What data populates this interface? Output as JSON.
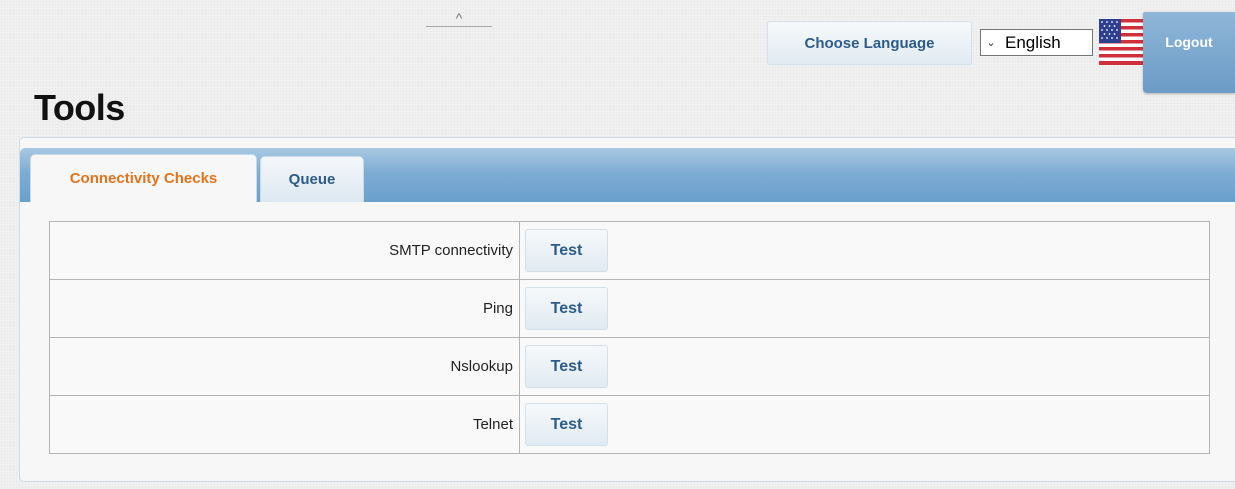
{
  "header": {
    "collapse_glyph": "^",
    "choose_language_label": "Choose Language",
    "language_selected": "English",
    "language_chevron": "⌄",
    "flag_icon": "us-flag-icon",
    "logout_label": "Logout"
  },
  "page": {
    "title": "Tools"
  },
  "tabs": [
    {
      "label": "Connectivity Checks",
      "active": true
    },
    {
      "label": "Queue",
      "active": false
    }
  ],
  "checks": [
    {
      "label": "SMTP connectivity",
      "button": "Test"
    },
    {
      "label": "Ping",
      "button": "Test"
    },
    {
      "label": "Nslookup",
      "button": "Test"
    },
    {
      "label": "Telnet",
      "button": "Test"
    }
  ],
  "colors": {
    "accent_blue": "#2d5c8a",
    "active_tab_text": "#e2731b",
    "tab_bar": "#7eacd3",
    "logout_bg": "#7ea8cf"
  }
}
